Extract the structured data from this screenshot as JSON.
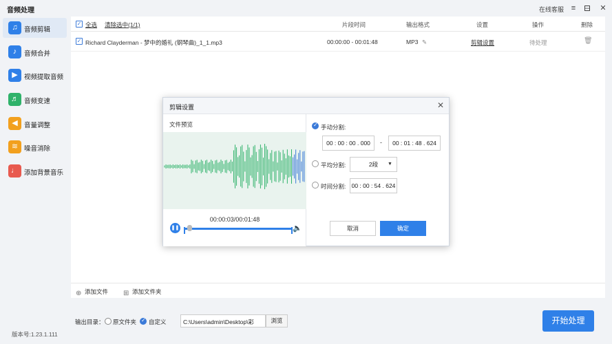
{
  "app": {
    "title": "音频处理",
    "online_service": "在线客服",
    "version": "版本号:1.23.1.111"
  },
  "sidebar": {
    "items": [
      {
        "label": "音频剪辑",
        "icon": "scissors-music-icon",
        "color": "#2f80e8",
        "active": true
      },
      {
        "label": "音频合并",
        "icon": "music-merge-icon",
        "color": "#2f80e8"
      },
      {
        "label": "视频提取音频",
        "icon": "video-extract-icon",
        "color": "#2f80e8"
      },
      {
        "label": "音频变速",
        "icon": "speed-icon",
        "color": "#2fb26a"
      },
      {
        "label": "音量调整",
        "icon": "volume-icon",
        "color": "#f2a01e"
      },
      {
        "label": "噪音消除",
        "icon": "noise-icon",
        "color": "#f2a01e"
      },
      {
        "label": "添加背景音乐",
        "icon": "bg-music-icon",
        "color": "#e85a4f"
      }
    ]
  },
  "table": {
    "select_all": "全选",
    "clear_selected": "清除选中(1/1)",
    "columns": {
      "segment_time": "片段时间",
      "output_format": "输出格式",
      "settings": "设置",
      "action": "操作",
      "delete": "删除"
    },
    "rows": [
      {
        "filename": "Richard Clayderman - 梦中的婚礼 (钢琴曲)_1_1.mp3",
        "segment_time": "00:00:00 - 00:01:48",
        "format": "MP3",
        "settings_link": "剪辑设置",
        "status": "待处理"
      }
    ]
  },
  "bottom_actions": {
    "add_file": "添加文件",
    "add_folder": "添加文件夹"
  },
  "output": {
    "label": "输出目录：",
    "option_original": "原文件夹",
    "option_custom": "自定义",
    "path": "C:\\Users\\admin\\Desktop\\彩",
    "browse": "浏览",
    "start": "开始处理"
  },
  "modal": {
    "title": "剪辑设置",
    "preview_label": "文件预览",
    "playback_time": "00:00:03/00:01:48",
    "playback_progress": 0.028,
    "manual_split_label": "手动分割:",
    "manual_start": "00 : 00 : 00 . 000",
    "manual_end": "00 : 01 : 48 . 624",
    "dash": "-",
    "avg_split_label": "平均分割:",
    "avg_split_value": "2段",
    "time_split_label": "时间分割:",
    "time_split_value": "00 : 00 : 54 . 624",
    "cancel": "取消",
    "confirm": "确定"
  },
  "colors": {
    "accent": "#2f80e8",
    "waveform": "#2fb26a",
    "waveform_tail": "#3b7ad8"
  }
}
